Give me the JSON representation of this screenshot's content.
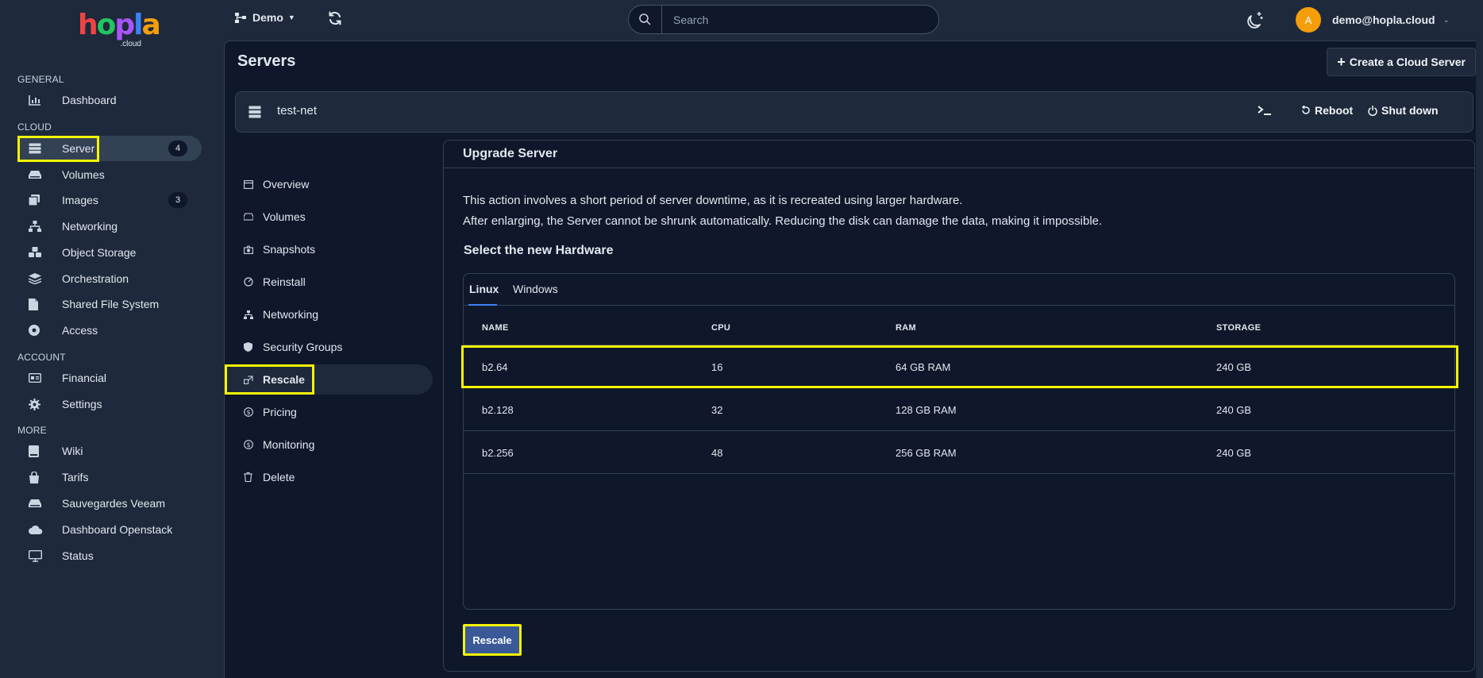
{
  "brand": {
    "logo_text": "hopla",
    "logo_sub": ".cloud"
  },
  "sidebar": {
    "sections": [
      {
        "title": "GENERAL"
      },
      {
        "title": "CLOUD"
      },
      {
        "title": "ACCOUNT"
      },
      {
        "title": "MORE"
      }
    ],
    "items": [
      {
        "label": "Dashboard",
        "icon": "chart-icon"
      },
      {
        "label": "Server",
        "icon": "server-icon",
        "count": "4",
        "active": true
      },
      {
        "label": "Volumes",
        "icon": "disk-icon"
      },
      {
        "label": "Images",
        "icon": "images-icon",
        "count": "3"
      },
      {
        "label": "Networking",
        "icon": "network-icon"
      },
      {
        "label": "Object Storage",
        "icon": "cubes-icon"
      },
      {
        "label": "Orchestration",
        "icon": "layers-icon"
      },
      {
        "label": "Shared File System",
        "icon": "file-icon"
      },
      {
        "label": "Access",
        "icon": "key-icon"
      },
      {
        "label": "Financial",
        "icon": "card-icon"
      },
      {
        "label": "Settings",
        "icon": "gear-icon"
      },
      {
        "label": "Wiki",
        "icon": "book-icon"
      },
      {
        "label": "Tarifs",
        "icon": "bag-icon"
      },
      {
        "label": "Sauvegardes Veeam",
        "icon": "drive-icon"
      },
      {
        "label": "Dashboard Openstack",
        "icon": "cloud-icon"
      },
      {
        "label": "Status",
        "icon": "monitor-icon"
      }
    ]
  },
  "topbar": {
    "project": "Demo",
    "search_placeholder": "Search",
    "avatar_initial": "A",
    "user_email": "demo@hopla.cloud"
  },
  "page": {
    "title": "Servers",
    "create_button": "Create a Cloud Server"
  },
  "server": {
    "name": "test-net",
    "reboot": "Reboot",
    "shutdown": "Shut down"
  },
  "subnav": [
    {
      "label": "Overview",
      "icon": "overview-icon"
    },
    {
      "label": "Volumes",
      "icon": "volume-icon"
    },
    {
      "label": "Snapshots",
      "icon": "snapshot-icon"
    },
    {
      "label": "Reinstall",
      "icon": "reinstall-icon"
    },
    {
      "label": "Networking",
      "icon": "network-icon"
    },
    {
      "label": "Security Groups",
      "icon": "shield-icon"
    },
    {
      "label": "Rescale",
      "icon": "rescale-icon",
      "active": true
    },
    {
      "label": "Pricing",
      "icon": "dollar-icon"
    },
    {
      "label": "Monitoring",
      "icon": "monitoring-icon"
    },
    {
      "label": "Delete",
      "icon": "trash-icon"
    }
  ],
  "upgrade": {
    "title": "Upgrade Server",
    "desc_line1": "This action involves a short period of server downtime, as it is recreated using larger hardware.",
    "desc_line2": "After enlarging, the Server cannot be shrunk automatically. Reducing the disk can damage the data, making it impossible.",
    "select_title": "Select the new Hardware",
    "tabs": [
      "Linux",
      "Windows"
    ],
    "columns": [
      "NAME",
      "CPU",
      "RAM",
      "STORAGE"
    ],
    "rows": [
      {
        "name": "b2.64",
        "cpu": "16",
        "ram": "64 GB RAM",
        "storage": "240 GB",
        "selected": true
      },
      {
        "name": "b2.128",
        "cpu": "32",
        "ram": "128 GB RAM",
        "storage": "240 GB"
      },
      {
        "name": "b2.256",
        "cpu": "48",
        "ram": "256 GB RAM",
        "storage": "240 GB"
      }
    ],
    "button": "Rescale"
  },
  "colors": {
    "highlight": "#f5f500",
    "accent": "#3b5998",
    "avatar": "#f59e0b"
  }
}
